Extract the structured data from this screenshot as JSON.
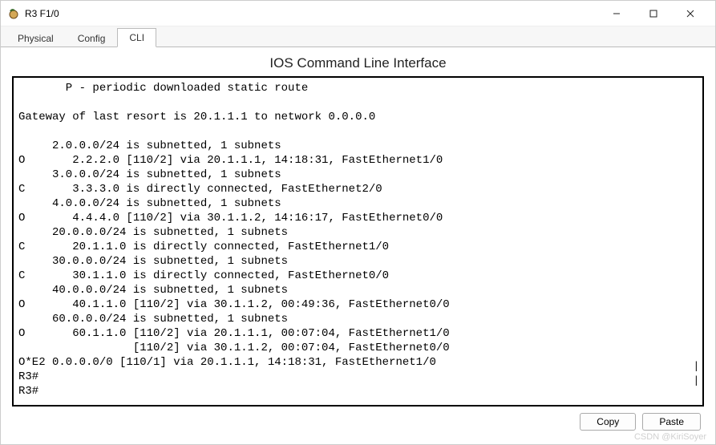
{
  "window": {
    "title": "R3 F1/0"
  },
  "tabs": {
    "physical": "Physical",
    "config": "Config",
    "cli": "CLI"
  },
  "heading": "IOS Command Line Interface",
  "terminal_lines": [
    "       P - periodic downloaded static route",
    "",
    "Gateway of last resort is 20.1.1.1 to network 0.0.0.0",
    "",
    "     2.0.0.0/24 is subnetted, 1 subnets",
    "O       2.2.2.0 [110/2] via 20.1.1.1, 14:18:31, FastEthernet1/0",
    "     3.0.0.0/24 is subnetted, 1 subnets",
    "C       3.3.3.0 is directly connected, FastEthernet2/0",
    "     4.0.0.0/24 is subnetted, 1 subnets",
    "O       4.4.4.0 [110/2] via 30.1.1.2, 14:16:17, FastEthernet0/0",
    "     20.0.0.0/24 is subnetted, 1 subnets",
    "C       20.1.1.0 is directly connected, FastEthernet1/0",
    "     30.0.0.0/24 is subnetted, 1 subnets",
    "C       30.1.1.0 is directly connected, FastEthernet0/0",
    "     40.0.0.0/24 is subnetted, 1 subnets",
    "O       40.1.1.0 [110/2] via 30.1.1.2, 00:49:36, FastEthernet0/0",
    "     60.0.0.0/24 is subnetted, 1 subnets",
    "O       60.1.1.0 [110/2] via 20.1.1.1, 00:07:04, FastEthernet1/0",
    "                 [110/2] via 30.1.1.2, 00:07:04, FastEthernet0/0",
    "O*E2 0.0.0.0/0 [110/1] via 20.1.1.1, 14:18:31, FastEthernet1/0",
    "R3#",
    "R3#"
  ],
  "buttons": {
    "copy": "Copy",
    "paste": "Paste"
  },
  "watermark": "CSDN @KiriSoyer"
}
